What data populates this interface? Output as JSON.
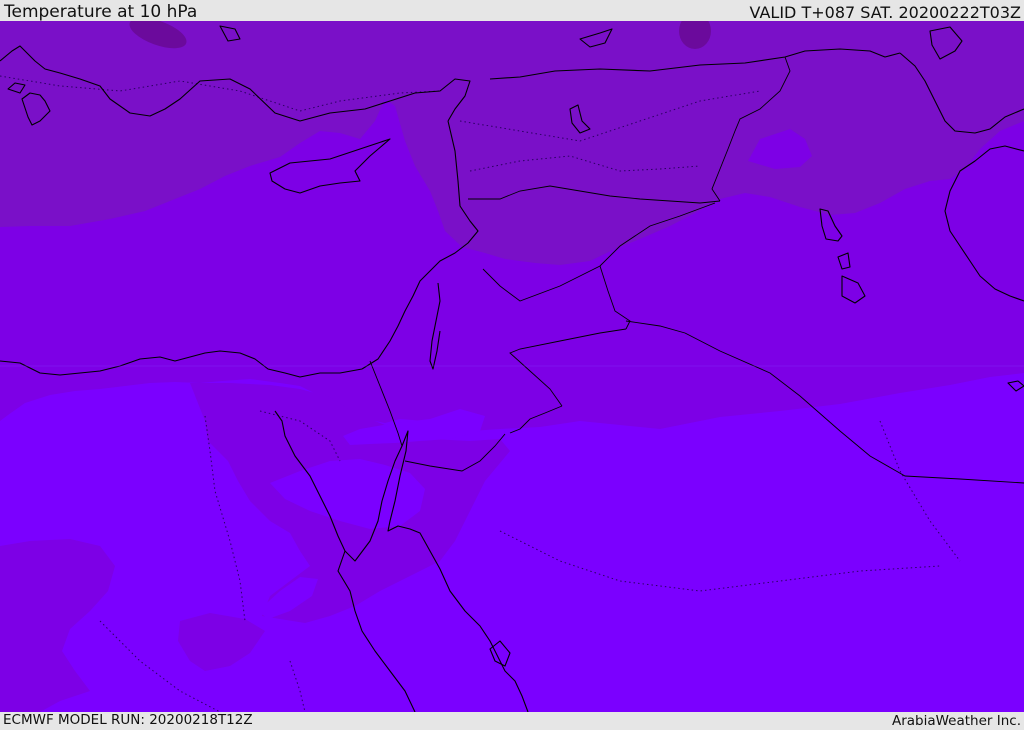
{
  "header": {
    "title": "Temperature at 10 hPa",
    "valid": "VALID T+087 SAT. 20200222T03Z"
  },
  "footer": {
    "model_run": "ECMWF MODEL RUN: 20200218T12Z",
    "credit": "ArabiaWeather Inc."
  },
  "colors": {
    "frame": "#e6e6e6",
    "band_warmest": "#7b00ff",
    "band_mid": "#7d00e6",
    "band_cool": "#7a10c8",
    "band_coldest": "#6b0a9c",
    "coastline": "#000000"
  },
  "map": {
    "variable": "temperature",
    "level": "10 hPa",
    "border-style": "dotted"
  }
}
